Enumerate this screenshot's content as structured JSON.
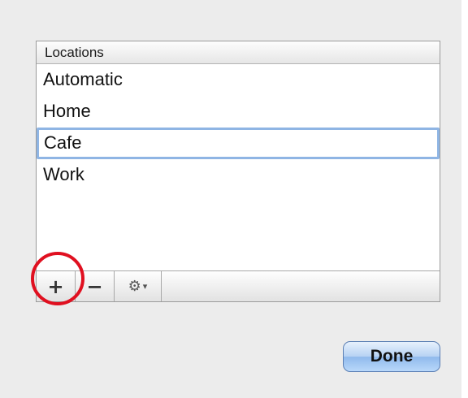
{
  "locations": {
    "header": "Locations",
    "items": [
      {
        "label": "Automatic"
      },
      {
        "label": "Home"
      },
      {
        "label": "Cafe"
      },
      {
        "label": "Work"
      }
    ],
    "editing_index": 2
  },
  "toolbar": {
    "add_label": "+",
    "remove_label": "−",
    "gear_label": "⚙",
    "gear_caret": "▾"
  },
  "done_label": "Done",
  "colors": {
    "highlight_circle": "#e01020",
    "selection_border": "#8fb5e4"
  }
}
